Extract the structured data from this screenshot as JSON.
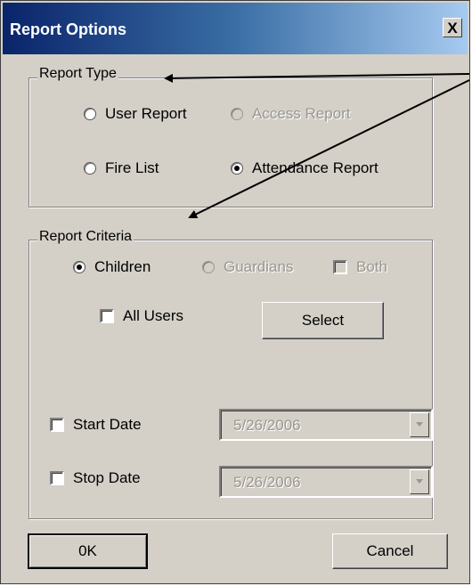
{
  "window": {
    "title": "Report Options",
    "close_label": "X"
  },
  "report_type": {
    "legend": "Report Type",
    "options": [
      {
        "label": "User  Report",
        "checked": false,
        "enabled": true
      },
      {
        "label": "Access Report",
        "checked": false,
        "enabled": false
      },
      {
        "label": "Fire List",
        "checked": false,
        "enabled": true
      },
      {
        "label": "Attendance Report",
        "checked": true,
        "enabled": true
      }
    ]
  },
  "report_criteria": {
    "legend": "Report Criteria",
    "children_label": "Children",
    "guardians_label": "Guardians",
    "both_label": "Both",
    "all_users_label": "All Users",
    "select_button": "Select",
    "start_date_label": "Start Date",
    "start_date_value": "5/26/2006",
    "stop_date_label": "Stop Date",
    "stop_date_value": "5/26/2006"
  },
  "buttons": {
    "ok": "0K",
    "cancel": "Cancel"
  },
  "colors": {
    "dialog_face": "#d4d0c8",
    "title_start": "#0a246a",
    "title_end": "#a6caf0",
    "disabled_text": "#9a9790"
  }
}
